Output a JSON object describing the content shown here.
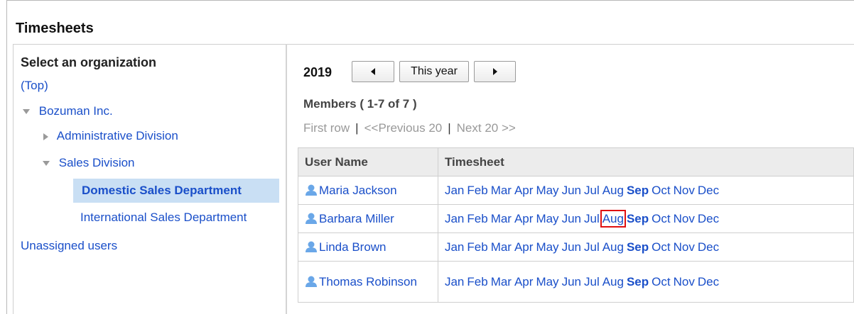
{
  "page_title": "Timesheets",
  "sidebar": {
    "heading": "Select an organization",
    "top_link": "(Top)",
    "company": "Bozuman Inc.",
    "admin_division": "Administrative Division",
    "sales_division": "Sales Division",
    "domestic": "Domestic Sales Department",
    "international": "International Sales Department",
    "unassigned": "Unassigned users"
  },
  "year_nav": {
    "year": "2019",
    "prev_icon": "caret-left-icon",
    "this_year": "This year",
    "next_icon": "caret-right-icon"
  },
  "members_label": "Members ( 1-7 of 7 )",
  "pager": {
    "first": "First row",
    "prev": "<<Previous 20",
    "next": "Next 20 >>"
  },
  "table": {
    "headers": [
      "User Name",
      "Timesheet"
    ],
    "months": [
      "Jan",
      "Feb",
      "Mar",
      "Apr",
      "May",
      "Jun",
      "Jul",
      "Aug",
      "Sep",
      "Oct",
      "Nov",
      "Dec"
    ],
    "current_month": "Sep",
    "rows": [
      {
        "name": "Maria Jackson"
      },
      {
        "name": "Barbara Miller",
        "highlighted_month": "Aug"
      },
      {
        "name": "Linda Brown"
      },
      {
        "name": "Thomas Robinson"
      }
    ]
  },
  "colors": {
    "link": "#1a4fc9",
    "selected_bg": "#c9dff4",
    "highlight": "#e01010"
  }
}
